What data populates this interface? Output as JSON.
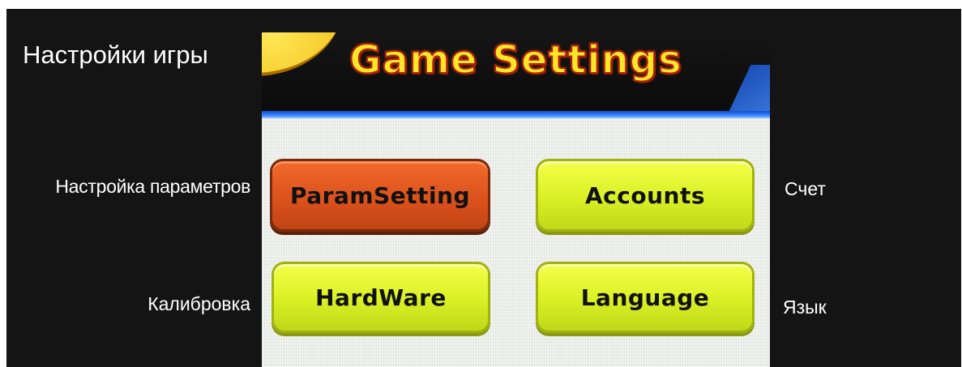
{
  "captions": {
    "title_ru": "Настройки игры",
    "param_ru": "Настройка параметров",
    "calibration_ru": "Калибровка",
    "accounts_ru": "Счет",
    "language_ru": "Язык"
  },
  "screen": {
    "title": "Game Settings",
    "buttons": {
      "param": "ParamSetting",
      "accounts": "Accounts",
      "hardware": "HardWare",
      "language": "Language"
    }
  },
  "colors": {
    "title_fill": "#ffe629",
    "title_outline": "#b2200c",
    "selected_button": "#d9501c",
    "button": "#d9f024",
    "accent_bar": "#2f77f5",
    "background": "#141414"
  },
  "state": {
    "selected_button": "ParamSetting"
  }
}
